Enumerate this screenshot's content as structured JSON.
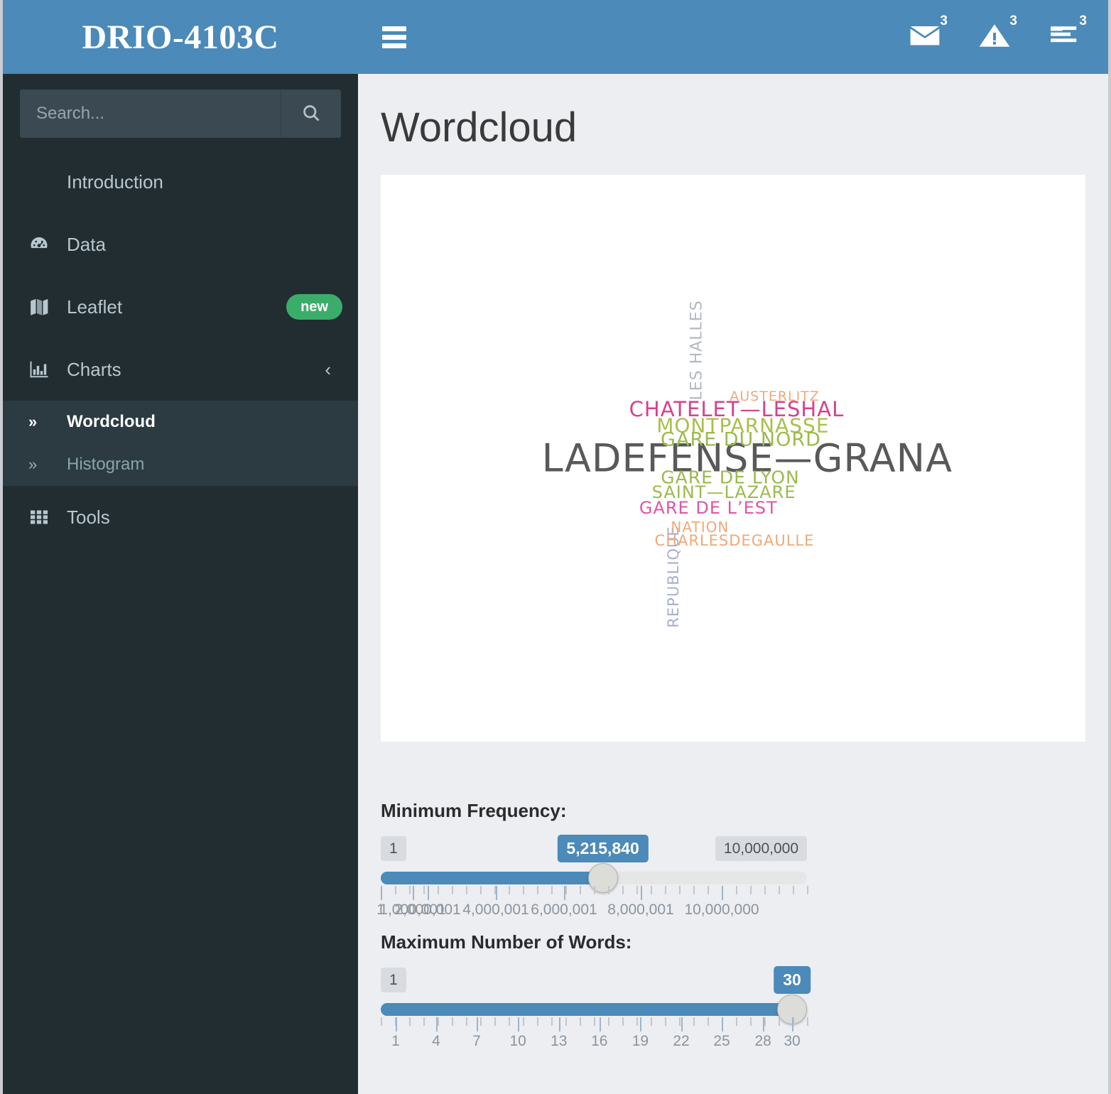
{
  "brand": {
    "title": "DRIO-4103C"
  },
  "search": {
    "placeholder": "Search...",
    "value": "",
    "icon": "search-icon"
  },
  "sidebar": {
    "items": [
      {
        "label": "Introduction",
        "icon": null,
        "badge": null,
        "expandable": false
      },
      {
        "label": "Data",
        "icon": "tachometer-icon",
        "badge": null,
        "expandable": false
      },
      {
        "label": "Leaflet",
        "icon": "map-icon",
        "badge": "new",
        "expandable": false
      },
      {
        "label": "Charts",
        "icon": "bar-chart-icon",
        "badge": null,
        "expandable": true,
        "chevron": "‹"
      },
      {
        "label": "Tools",
        "icon": "grid-icon",
        "badge": null,
        "expandable": false
      }
    ],
    "submenu": [
      {
        "label": "Wordcloud",
        "active": true,
        "marker": "»"
      },
      {
        "label": "Histogram",
        "active": false,
        "marker": "»"
      }
    ]
  },
  "navbar": {
    "toggle_icon": "hamburger-icon",
    "icons": [
      {
        "name": "envelope-icon",
        "badge": "3"
      },
      {
        "name": "warning-triangle-icon",
        "badge": "3"
      },
      {
        "name": "tasks-icon",
        "badge": "3"
      }
    ]
  },
  "page": {
    "title": "Wordcloud"
  },
  "chart_data": {
    "type": "wordcloud",
    "title": "Wordcloud",
    "background": "#ffffff",
    "words": [
      {
        "text": "LADEFENSE—GRANA",
        "size": 54,
        "color": "#595959",
        "rotate": 0,
        "x": 52,
        "y": 50
      },
      {
        "text": "CHATELET—LESHAL",
        "size": 29,
        "color": "#d6418e",
        "rotate": 0,
        "x": 50.5,
        "y": 41.4
      },
      {
        "text": "MONTPARNASSE",
        "size": 28,
        "color": "#a8c04a",
        "rotate": 0,
        "x": 51.4,
        "y": 44.2
      },
      {
        "text": "GARE DU NORD",
        "size": 27,
        "color": "#9aba4e",
        "rotate": 0,
        "x": 51.1,
        "y": 46.8
      },
      {
        "text": "GARE DE LYON",
        "size": 25,
        "color": "#9aba4e",
        "rotate": 0,
        "x": 49.6,
        "y": 53.4
      },
      {
        "text": "SAINT—LAZARE",
        "size": 24,
        "color": "#9aba4e",
        "rotate": 0,
        "x": 48.7,
        "y": 56.1
      },
      {
        "text": "GARE DE L’EST",
        "size": 24,
        "color": "#e055a0",
        "rotate": 0,
        "x": 46.5,
        "y": 58.8
      },
      {
        "text": "LES HALLES",
        "size": 22,
        "color": "#b4b9c2",
        "rotate": -90,
        "x": 44.9,
        "y": 31.0
      },
      {
        "text": "AUSTERLITZ",
        "size": 19,
        "color": "#f0a878",
        "rotate": 0,
        "x": 55.9,
        "y": 39.1
      },
      {
        "text": "REPUBLIQUE",
        "size": 21,
        "color": "#a8aed0",
        "rotate": -90,
        "x": 41.5,
        "y": 71.0
      },
      {
        "text": "NATION",
        "size": 20,
        "color": "#f0a878",
        "rotate": 0,
        "x": 45.3,
        "y": 62.2
      },
      {
        "text": "CHARLESDEGAULLE",
        "size": 21,
        "color": "#f0a878",
        "rotate": 0,
        "x": 50.2,
        "y": 64.5
      }
    ]
  },
  "controls": {
    "min_frequency": {
      "label": "Minimum Frequency:",
      "min_label": "1",
      "max_label": "10,000,000",
      "value_label": "5,215,840",
      "min": 1,
      "max": 10000000,
      "value": 5215840,
      "fill_percent": 52.1,
      "tick_labels": [
        "1",
        "1,000,001",
        "2,000,001",
        "4,000,001",
        "6,000,001",
        "8,000,001",
        "10,000,000"
      ],
      "tick_positions": [
        0,
        7.5,
        11.0,
        27.0,
        43.0,
        61.0,
        80.0
      ]
    },
    "max_words": {
      "label": "Maximum Number of Words:",
      "min_label": "1",
      "max_label": "",
      "value_label": "30",
      "min": 1,
      "max": 30,
      "value": 30,
      "fill_percent": 96.5,
      "tick_labels": [
        "1",
        "4",
        "7",
        "10",
        "13",
        "16",
        "19",
        "22",
        "25",
        "28",
        "30"
      ],
      "tick_positions": [
        3.5,
        13.0,
        22.5,
        32.2,
        41.8,
        51.3,
        60.9,
        70.5,
        80.0,
        89.7,
        96.5
      ]
    }
  },
  "colors": {
    "brand_blue": "#4b8ab9",
    "sidebar_dark": "#222d32",
    "sidebar_submenu": "#2c3b41",
    "badge_green": "#3bad6a",
    "content_bg": "#eceef2"
  }
}
